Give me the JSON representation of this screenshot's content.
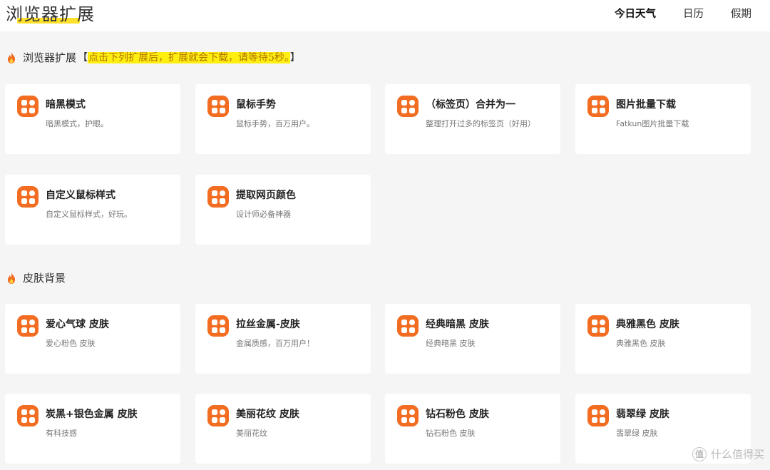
{
  "header": {
    "site_title": "浏览器扩展",
    "nav": [
      {
        "label": "今日天气",
        "active": true
      },
      {
        "label": "日历",
        "active": false
      },
      {
        "label": "假期",
        "active": false
      }
    ]
  },
  "sections": [
    {
      "title": "浏览器扩展",
      "notice": "【点击下列扩展后，扩展就会下载，请等待5秒。】",
      "notice_bracket_open": "【",
      "notice_text": "点击下列扩展后，扩展就会下载，请等待5秒。",
      "notice_bracket_close": "】",
      "cards": [
        {
          "title": "暗黑模式",
          "desc": "暗黑模式，护眼。"
        },
        {
          "title": "鼠标手势",
          "desc": "鼠标手势，百万用户。"
        },
        {
          "title": "（标签页）合并为一",
          "desc": "整理打开过多的标签页（好用）"
        },
        {
          "title": "图片批量下载",
          "desc": "Fatkun图片批量下载"
        },
        {
          "title": "自定义鼠标样式",
          "desc": "自定义鼠标样式，好玩。"
        },
        {
          "title": "提取网页颜色",
          "desc": "设计师必备神器"
        }
      ]
    },
    {
      "title": "皮肤背景",
      "cards": [
        {
          "title": "爱心气球 皮肤",
          "desc": "爱心粉色 皮肤"
        },
        {
          "title": "拉丝金属-皮肤",
          "desc": "金属质感，百万用户！"
        },
        {
          "title": "经典暗黑 皮肤",
          "desc": "经典暗黑 皮肤"
        },
        {
          "title": "典雅黑色 皮肤",
          "desc": "典雅黑色 皮肤"
        },
        {
          "title": "炭黑+银色金属 皮肤",
          "desc": "有科技感"
        },
        {
          "title": "美丽花纹 皮肤",
          "desc": "美丽花纹"
        },
        {
          "title": "钻石粉色 皮肤",
          "desc": "钻石粉色 皮肤"
        },
        {
          "title": "翡翠绿 皮肤",
          "desc": "翡翠绿 皮肤"
        }
      ]
    }
  ],
  "watermark": {
    "text": "什么值得买"
  },
  "colors": {
    "accent": "#f26d21",
    "highlight": "#ffef11",
    "underline": "#ffe12b",
    "page_bg": "#f5f5f5",
    "card_bg": "#ffffff"
  },
  "icons": {
    "section": "fire-icon",
    "card": "app-grid-icon"
  }
}
